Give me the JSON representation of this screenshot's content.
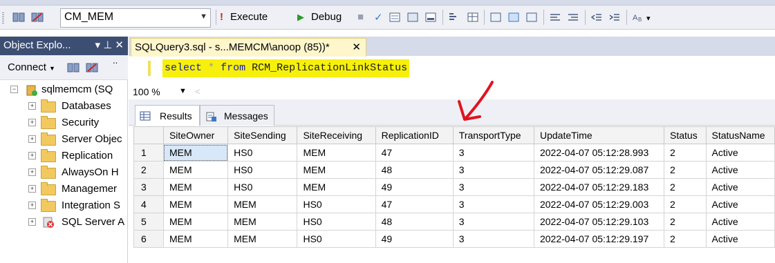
{
  "toolbar": {
    "database": "CM_MEM",
    "execute_label": "Execute",
    "debug_label": "Debug"
  },
  "object_explorer": {
    "title": "Object Explo...",
    "title_controls": "▾ ⊥ ✕",
    "connect_label": "Connect",
    "server_label": "sqlmemcm (SQ",
    "nodes": [
      "Databases",
      "Security",
      "Server Objec",
      "Replication",
      "AlwaysOn H",
      "Managemer",
      "Integration S",
      "SQL Server A"
    ]
  },
  "query_tab": {
    "title": "SQLQuery3.sql - s...MEMCM\\anoop (85))*",
    "close": "✕"
  },
  "editor": {
    "kw1": "select",
    "star": "*",
    "kw2": "from",
    "table": "RCM_ReplicationLinkStatus"
  },
  "zoom": "100 %",
  "results_tabs": {
    "results": "Results",
    "messages": "Messages"
  },
  "grid": {
    "columns": [
      "SiteOwner",
      "SiteSending",
      "SiteReceiving",
      "ReplicationID",
      "TransportType",
      "UpdateTime",
      "Status",
      "StatusName"
    ],
    "rows": [
      [
        "1",
        "MEM",
        "HS0",
        "MEM",
        "47",
        "3",
        "2022-04-07 05:12:28.993",
        "2",
        "Active"
      ],
      [
        "2",
        "MEM",
        "HS0",
        "MEM",
        "48",
        "3",
        "2022-04-07 05:12:29.087",
        "2",
        "Active"
      ],
      [
        "3",
        "MEM",
        "HS0",
        "MEM",
        "49",
        "3",
        "2022-04-07 05:12:29.183",
        "2",
        "Active"
      ],
      [
        "4",
        "MEM",
        "MEM",
        "HS0",
        "47",
        "3",
        "2022-04-07 05:12:29.003",
        "2",
        "Active"
      ],
      [
        "5",
        "MEM",
        "MEM",
        "HS0",
        "48",
        "3",
        "2022-04-07 05:12:29.103",
        "2",
        "Active"
      ],
      [
        "6",
        "MEM",
        "MEM",
        "HS0",
        "49",
        "3",
        "2022-04-07 05:12:29.197",
        "2",
        "Active"
      ]
    ]
  },
  "colors": {
    "highlight": "#f6f00c",
    "annotation": "#e0141e",
    "panel_title": "#3c4f73"
  }
}
